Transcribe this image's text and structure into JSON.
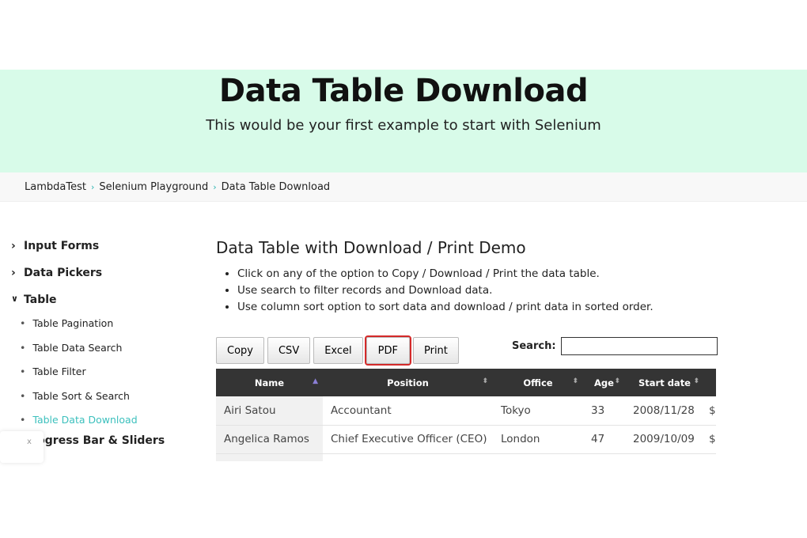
{
  "hero": {
    "title": "Data Table Download",
    "subtitle": "This would be your first example to start with Selenium"
  },
  "breadcrumb": [
    "LambdaTest",
    "Selenium Playground",
    "Data Table Download"
  ],
  "sidebar": {
    "groups": [
      {
        "label": "Input Forms",
        "chevron": "chevron-right"
      },
      {
        "label": "Data Pickers",
        "chevron": "chevron-right"
      },
      {
        "label": "Table",
        "chevron": "chevron-down"
      }
    ],
    "items": [
      "Table Pagination",
      "Table Data Search",
      "Table Filter",
      "Table Sort & Search",
      "Table Data Download"
    ],
    "next_group": "Progress Bar & Sliders",
    "active_color": "#3cc0bd"
  },
  "main": {
    "title": "Data Table with Download / Print Demo",
    "bullets": [
      "Click on any of the option to Copy / Download / Print the data table.",
      "Use search to filter records and Download data.",
      "Use column sort option to sort data and download / print data in sorted order."
    ]
  },
  "toolbar": {
    "buttons": [
      "Copy",
      "CSV",
      "Excel",
      "PDF",
      "Print"
    ],
    "highlighted": "PDF"
  },
  "search": {
    "label": "Search:",
    "value": ""
  },
  "table": {
    "headers": [
      "Name",
      "Position",
      "Office",
      "Age",
      "Start date"
    ],
    "rows": [
      [
        "Airi Satou",
        "Accountant",
        "Tokyo",
        "33",
        "2008/11/28",
        "$"
      ],
      [
        "Angelica Ramos",
        "Chief Executive Officer (CEO)",
        "London",
        "47",
        "2009/10/09",
        "$"
      ]
    ]
  },
  "popup": {
    "close": "x"
  }
}
